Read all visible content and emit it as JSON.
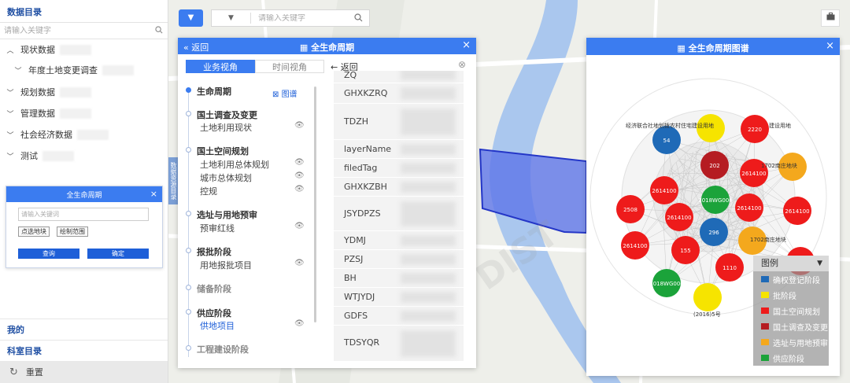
{
  "catalog": {
    "title": "数据目录",
    "search_placeholder": "请输入关键字",
    "items": [
      {
        "label": "现状数据",
        "chevron": "expanded"
      },
      {
        "label": "年度土地变更调查",
        "chevron": "expanded"
      },
      {
        "label": "规划数据",
        "chevron": "collapsed"
      },
      {
        "label": "管理数据",
        "chevron": "collapsed"
      },
      {
        "label": "社会经济数据",
        "chevron": "collapsed"
      },
      {
        "label": "测试",
        "chevron": "collapsed"
      }
    ],
    "mine": "我的",
    "dept_catalog": "科室目录",
    "reset": "重置"
  },
  "mini_dialog": {
    "title": "全生命周期",
    "placeholder": "请输入关键词",
    "btn_select_block": "点选地块",
    "btn_draw_range": "绘制范围",
    "btn_query": "查询",
    "btn_confirm": "确定"
  },
  "map_toolbar": {
    "search_placeholder": "请输入关键字"
  },
  "side_handle": "数据资源目录",
  "lifecycle_panel": {
    "back": "返回",
    "title": "全生命周期",
    "tabs": [
      {
        "label": "业务视角",
        "active": true
      },
      {
        "label": "时间视角",
        "active": false
      }
    ],
    "header": "生命周期",
    "graph_link": "图谱",
    "stages": [
      {
        "name": "国土调查及变更",
        "items": [
          "土地利用现状"
        ]
      },
      {
        "name": "国土空间规划",
        "items": [
          "土地利用总体规划",
          "城市总体规划",
          "控规"
        ]
      },
      {
        "name": "选址与用地预审",
        "items": [
          "预审红线"
        ]
      },
      {
        "name": "报批阶段",
        "items": [
          "用地报批项目"
        ]
      },
      {
        "name": "储备阶段",
        "items": []
      },
      {
        "name": "供应阶段",
        "items": [
          "供地项目"
        ],
        "active_item": "供地项目"
      },
      {
        "name": "工程建设阶段",
        "items": []
      }
    ],
    "fields_back": "返回",
    "fields": [
      "ZQ",
      "GHXKZRQ",
      "TDZH",
      "layerName",
      "filedTag",
      "GHXKZBH",
      "JSYDPZS",
      "YDMJ",
      "PZSJ",
      "BH",
      "WTJYDJ",
      "GDFS",
      "TDSYQR"
    ]
  },
  "graph_panel": {
    "title": "全生命周期图谱",
    "nodes": [
      {
        "label": "54",
        "category": "确权登记阶段",
        "color": "#1f6ab7"
      },
      {
        "label": "",
        "category": "批阶段",
        "color": "#f6e400"
      },
      {
        "label": "2220",
        "category": "国土空间规划",
        "color": "#ee1b1b"
      },
      {
        "label": "202",
        "category": "国土调查及变更",
        "color": "#b51c22"
      },
      {
        "label": "2614100",
        "category": "国土空间规划",
        "color": "#ee1b1b"
      },
      {
        "label": "",
        "category": "选址与用地预审",
        "color": "#f4a81d"
      },
      {
        "label": "2614100",
        "category": "国土空间规划",
        "color": "#ee1b1b"
      },
      {
        "label": "2508",
        "category": "国土空间规划",
        "color": "#ee1b1b"
      },
      {
        "label": "2614100",
        "category": "国土空间规划",
        "color": "#ee1b1b"
      },
      {
        "label": "2018WG006",
        "category": "供应阶段",
        "color": "#1ba33a"
      },
      {
        "label": "2614100",
        "category": "国土空间规划",
        "color": "#ee1b1b"
      },
      {
        "label": "2614100",
        "category": "国土空间规划",
        "color": "#ee1b1b"
      },
      {
        "label": "296",
        "category": "确权登记阶段",
        "color": "#1f6ab7"
      },
      {
        "label": "",
        "category": "选址与用地预审",
        "color": "#f4a81d"
      },
      {
        "label": "2614100",
        "category": "国土空间规划",
        "color": "#ee1b1b"
      },
      {
        "label": "155",
        "category": "国土空间规划",
        "color": "#ee1b1b"
      },
      {
        "label": "1110",
        "category": "国土空间规划",
        "color": "#ee1b1b"
      },
      {
        "label": "2614100",
        "category": "国土空间规划",
        "color": "#ee1b1b"
      },
      {
        "label": "2018WG006",
        "category": "供应阶段",
        "color": "#1ba33a"
      },
      {
        "label": "",
        "category": "批阶段",
        "color": "#f6e400"
      }
    ],
    "annotations": [
      "经济联合社地划拨农村住宅建设用地",
      "建设用地",
      "1702南庄地块",
      "1702南庄地块",
      "(2016)5号"
    ],
    "legend_title": "图例",
    "legend": [
      {
        "label": "确权登记阶段",
        "color": "#1f6ab7"
      },
      {
        "label": "批阶段",
        "color": "#f6e400"
      },
      {
        "label": "国土空间规划",
        "color": "#ee1b1b"
      },
      {
        "label": "国土调查及变更",
        "color": "#b51c22"
      },
      {
        "label": "选址与用地预审",
        "color": "#f4a81d"
      },
      {
        "label": "供应阶段",
        "color": "#1ba33a"
      }
    ]
  },
  "watermark": "DIST"
}
